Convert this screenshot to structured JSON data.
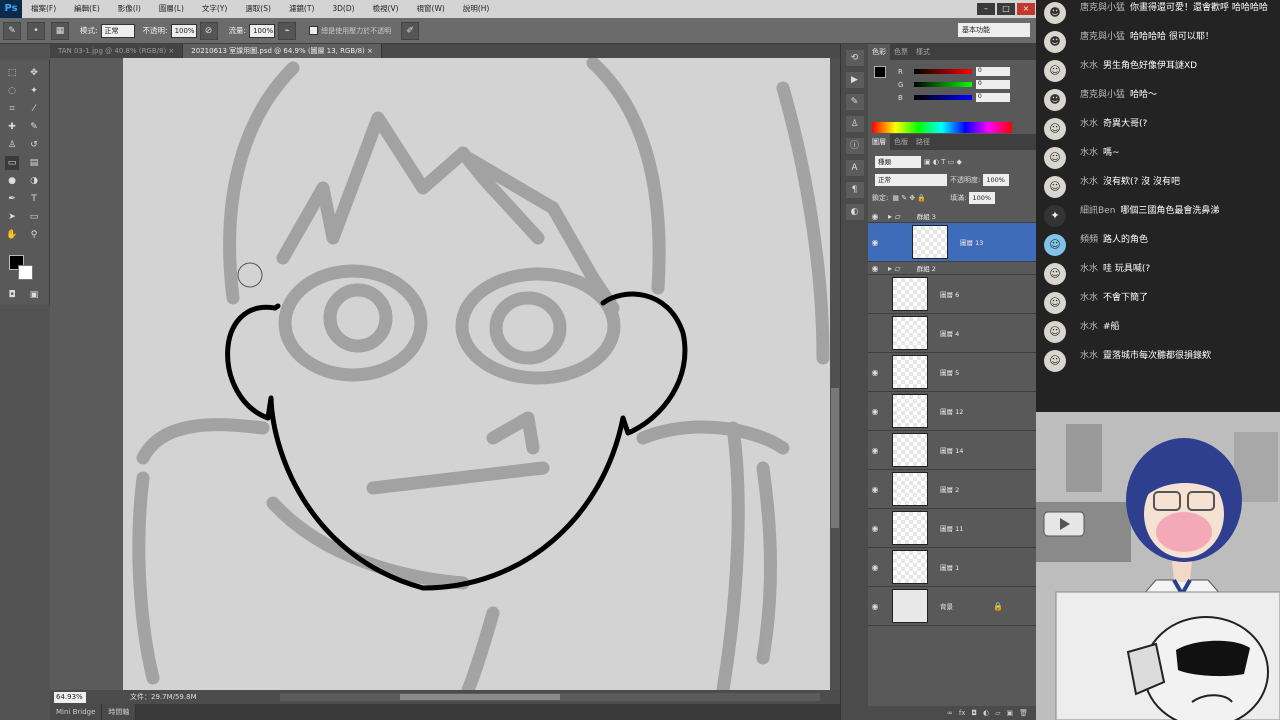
{
  "app": {
    "logo": "Ps"
  },
  "menubar": {
    "items": [
      "檔案(F)",
      "編輯(E)",
      "影像(I)",
      "圖層(L)",
      "文字(Y)",
      "選取(S)",
      "濾鏡(T)",
      "3D(D)",
      "檢視(V)",
      "視窗(W)",
      "說明(H)"
    ]
  },
  "options": {
    "mode_label": "模式:",
    "mode_value": "正常",
    "opacity_label": "不透明:",
    "opacity_value": "100%",
    "flow_label": "流量:",
    "flow_value": "100%",
    "airbrush_label": "總是使用壓力於不透明",
    "workspace": "基本功能"
  },
  "doc_tabs": [
    {
      "label": "TAN 03-1.jpg @ 40.8% (RGB/8) ×"
    },
    {
      "label": "20210613 室課用圖.psd @ 64.9% (圖層 13, RGB/8) ×"
    }
  ],
  "status": {
    "zoom": "64.93%",
    "doc_size": "文件：29.7M/59.8M"
  },
  "bottom_tabs": [
    "Mini Bridge",
    "時間軸"
  ],
  "color_panel": {
    "tabs": [
      "色彩",
      "色票",
      "樣式"
    ],
    "r": "0",
    "g": "0",
    "b": "0"
  },
  "layers_panel": {
    "tabs": [
      "圖層",
      "色版",
      "路徑"
    ],
    "filter": "種類",
    "blend": "正常",
    "opacity_label": "不透明度:",
    "opacity": "100%",
    "lock_label": "鎖定:",
    "fill_label": "填滿:",
    "fill": "100%",
    "layers": [
      {
        "name": "群組 3",
        "type": "group"
      },
      {
        "name": "圖層 13",
        "type": "layer",
        "selected": true
      },
      {
        "name": "群組 2",
        "type": "group"
      },
      {
        "name": "圖層 6",
        "type": "layer"
      },
      {
        "name": "圖層 4",
        "type": "layer"
      },
      {
        "name": "圖層 5",
        "type": "layer"
      },
      {
        "name": "圖層 12",
        "type": "layer"
      },
      {
        "name": "圖層 14",
        "type": "layer"
      },
      {
        "name": "圖層 2",
        "type": "layer"
      },
      {
        "name": "圖層 11",
        "type": "layer"
      },
      {
        "name": "圖層 1",
        "type": "layer"
      },
      {
        "name": "背景",
        "type": "layer"
      }
    ]
  },
  "chat": [
    {
      "user": "唐克與小猛",
      "text": "你畫得還可愛！還會歡呼 哈哈哈哈"
    },
    {
      "user": "唐克與小猛",
      "text": "哈哈哈哈 很可以耶！"
    },
    {
      "user": "水水",
      "text": "男生角色好像伊耳謎XD"
    },
    {
      "user": "唐克與小猛",
      "text": "哈哈～"
    },
    {
      "user": "水水",
      "text": "奇異大哥(?"
    },
    {
      "user": "水水",
      "text": "嗎~"
    },
    {
      "user": "水水",
      "text": "沒有欸(? 沒 沒有吧"
    },
    {
      "user": "細訊Ben",
      "text": "哪個三國角色最會洗鼻涕"
    },
    {
      "user": "頻頻",
      "text": "路人的角色"
    },
    {
      "user": "水水",
      "text": "哇 玩具喊(?"
    },
    {
      "user": "水水",
      "text": "不會下簡了"
    },
    {
      "user": "水水",
      "text": "#船"
    },
    {
      "user": "水水",
      "text": "靈落城市每次聽都很損錄欸"
    }
  ]
}
